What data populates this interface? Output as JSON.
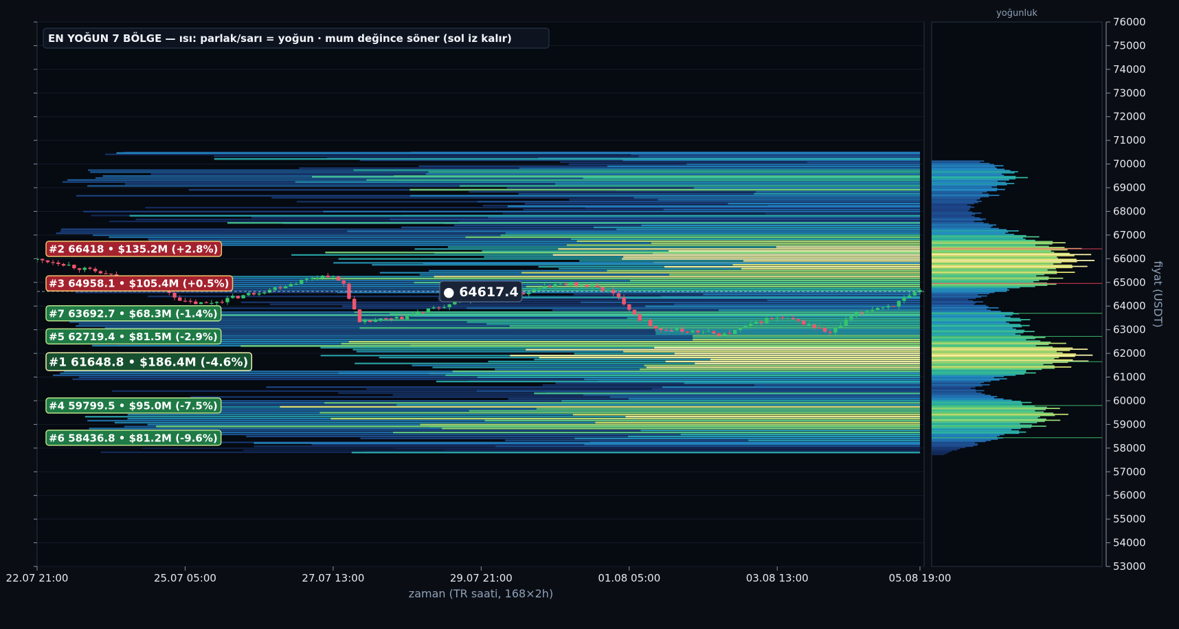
{
  "chart_data": {
    "type": "heatmap",
    "title": "EN YOĞUN 7 BÖLGE — ısı: parlak/sarı = yoğun · mum değince söner (sol iz kalır)",
    "xlabel": "zaman (TR saati, 168×2h)",
    "ylabel": "fiyat (USDT)",
    "profile_label": "yoğunluk",
    "ylim": [
      53000,
      76000
    ],
    "yticks": [
      53000,
      54000,
      55000,
      56000,
      57000,
      58000,
      59000,
      60000,
      61000,
      62000,
      63000,
      64000,
      65000,
      66000,
      67000,
      68000,
      69000,
      70000,
      71000,
      72000,
      73000,
      74000,
      75000,
      76000
    ],
    "xlim_hours": [
      0,
      334
    ],
    "xticks": [
      "22.07 21:00",
      "25.07 05:00",
      "27.07 13:00",
      "29.07 21:00",
      "01.08 05:00",
      "03.08 13:00",
      "05.08 19:00"
    ],
    "xticks_hours": [
      0,
      56,
      112,
      168,
      224,
      280,
      334
    ],
    "current_price": "● 64617.4",
    "current_price_value": 64617.4,
    "zones": [
      {
        "rank": "#2",
        "text": "#2  66418  •  $135.2M  (+2.8%)",
        "price": 66418,
        "kind": "up"
      },
      {
        "rank": "#3",
        "text": "#3  64958.1  •  $105.4M  (+0.5%)",
        "price": 64958.1,
        "kind": "up"
      },
      {
        "rank": "#7",
        "text": "#7  63692.7  •  $68.3M  (-1.4%)",
        "price": 63692.7,
        "kind": "down"
      },
      {
        "rank": "#5",
        "text": "#5  62719.4  •  $81.5M  (-2.9%)",
        "price": 62719.4,
        "kind": "down"
      },
      {
        "rank": "#1",
        "text": "#1  61648.8  •  $186.4M  (-4.6%)",
        "price": 61648.8,
        "kind": "top"
      },
      {
        "rank": "#4",
        "text": "#4  59799.5  •  $95.0M  (-7.5%)",
        "price": 59799.5,
        "kind": "down"
      },
      {
        "rank": "#6",
        "text": "#6  58436.8  •  $81.2M  (-9.6%)",
        "price": 58436.8,
        "kind": "down"
      }
    ],
    "price_path": {
      "x_hours": [
        0,
        8,
        16,
        24,
        32,
        40,
        48,
        56,
        64,
        72,
        80,
        88,
        96,
        104,
        110,
        116,
        122,
        128,
        136,
        144,
        152,
        160,
        168,
        176,
        184,
        192,
        200,
        208,
        216,
        222,
        228,
        236,
        244,
        252,
        260,
        268,
        276,
        280,
        286,
        292,
        300,
        308,
        316,
        324,
        334
      ],
      "y": [
        65950,
        65850,
        65600,
        65400,
        65150,
        64950,
        64700,
        64150,
        64100,
        64300,
        64500,
        64700,
        64950,
        65200,
        65300,
        64950,
        63250,
        63400,
        63450,
        63700,
        63950,
        64150,
        64450,
        64200,
        64550,
        64800,
        64950,
        64850,
        64650,
        64150,
        63450,
        63000,
        62950,
        62900,
        62800,
        63100,
        63450,
        63500,
        63400,
        63200,
        62850,
        63550,
        63900,
        64050,
        64617
      ]
    },
    "heat_levels": [
      {
        "y": 70400,
        "v": 0.3
      },
      {
        "y": 70150,
        "v": 0.35
      },
      {
        "y": 69900,
        "v": 0.45
      },
      {
        "y": 69650,
        "v": 0.55
      },
      {
        "y": 69400,
        "v": 0.58
      },
      {
        "y": 69150,
        "v": 0.5
      },
      {
        "y": 68900,
        "v": 0.45
      },
      {
        "y": 68650,
        "v": 0.4
      },
      {
        "y": 68400,
        "v": 0.32
      },
      {
        "y": 68150,
        "v": 0.28
      },
      {
        "y": 67900,
        "v": 0.3
      },
      {
        "y": 67650,
        "v": 0.33
      },
      {
        "y": 67400,
        "v": 0.4
      },
      {
        "y": 67150,
        "v": 0.52
      },
      {
        "y": 66900,
        "v": 0.65
      },
      {
        "y": 66650,
        "v": 0.82
      },
      {
        "y": 66400,
        "v": 0.92
      },
      {
        "y": 66150,
        "v": 0.97
      },
      {
        "y": 65900,
        "v": 1.0
      },
      {
        "y": 65650,
        "v": 0.95
      },
      {
        "y": 65400,
        "v": 0.88
      },
      {
        "y": 65150,
        "v": 0.82
      },
      {
        "y": 64900,
        "v": 0.78
      },
      {
        "y": 64650,
        "v": 0.5
      },
      {
        "y": 64400,
        "v": 0.34
      },
      {
        "y": 64150,
        "v": 0.3
      },
      {
        "y": 63900,
        "v": 0.4
      },
      {
        "y": 63650,
        "v": 0.55
      },
      {
        "y": 63400,
        "v": 0.6
      },
      {
        "y": 63150,
        "v": 0.62
      },
      {
        "y": 62900,
        "v": 0.64
      },
      {
        "y": 62650,
        "v": 0.7
      },
      {
        "y": 62400,
        "v": 0.82
      },
      {
        "y": 62150,
        "v": 0.95
      },
      {
        "y": 61900,
        "v": 1.0
      },
      {
        "y": 61650,
        "v": 0.96
      },
      {
        "y": 61400,
        "v": 0.86
      },
      {
        "y": 61150,
        "v": 0.66
      },
      {
        "y": 60900,
        "v": 0.45
      },
      {
        "y": 60650,
        "v": 0.36
      },
      {
        "y": 60400,
        "v": 0.32
      },
      {
        "y": 60150,
        "v": 0.42
      },
      {
        "y": 59900,
        "v": 0.62
      },
      {
        "y": 59650,
        "v": 0.78
      },
      {
        "y": 59400,
        "v": 0.85
      },
      {
        "y": 59150,
        "v": 0.8
      },
      {
        "y": 58900,
        "v": 0.7
      },
      {
        "y": 58650,
        "v": 0.58
      },
      {
        "y": 58400,
        "v": 0.45
      },
      {
        "y": 58150,
        "v": 0.3
      },
      {
        "y": 57900,
        "v": 0.15
      }
    ]
  }
}
